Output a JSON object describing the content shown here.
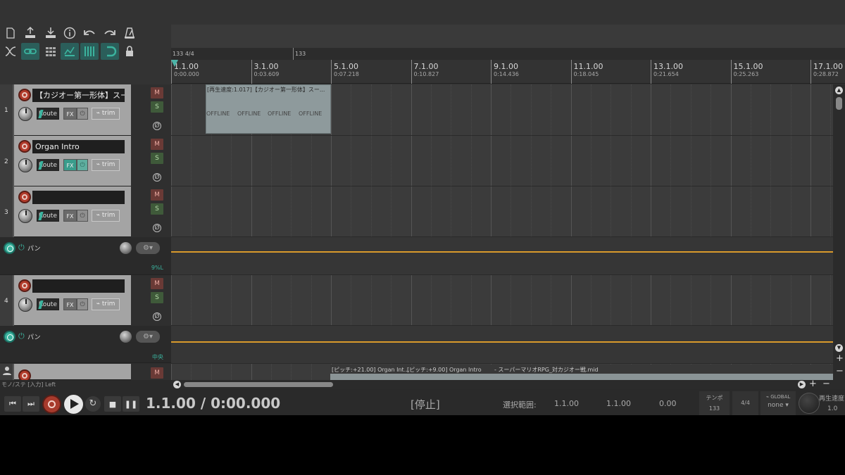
{
  "toolbar": {
    "row1": [
      "new-project-icon",
      "save-project-icon",
      "save-as-icon",
      "info-icon",
      "undo-icon",
      "redo-icon",
      "metronome-icon"
    ],
    "row2": [
      "ripple-off-icon",
      "link-icon",
      "grid-icon",
      "envelope-icon",
      "snap-grid-icon",
      "snap-magnet-icon",
      "lock-icon"
    ]
  },
  "tempo_lane": {
    "start_label": "133 4/4",
    "marker_label": "133"
  },
  "ruler": [
    {
      "bar": "1.1.00",
      "time": "0:00.000"
    },
    {
      "bar": "3.1.00",
      "time": "0:03.609"
    },
    {
      "bar": "5.1.00",
      "time": "0:07.218"
    },
    {
      "bar": "7.1.00",
      "time": "0:10.827"
    },
    {
      "bar": "9.1.00",
      "time": "0:14.436"
    },
    {
      "bar": "11.1.00",
      "time": "0:18.045"
    },
    {
      "bar": "13.1.00",
      "time": "0:21.654"
    },
    {
      "bar": "15.1.00",
      "time": "0:25.263"
    },
    {
      "bar": "17.1.00",
      "time": "0:28.872"
    }
  ],
  "tracks": [
    {
      "num": "1",
      "name": "【カジオー第一形体】スーパ",
      "route": "Route",
      "fx": "FX",
      "trim": "trim",
      "mute": "M",
      "solo": "S",
      "phase": "Ø"
    },
    {
      "num": "2",
      "name": "Organ Intro",
      "route": "Route",
      "fx": "FX",
      "trim": "trim",
      "mute": "M",
      "solo": "S",
      "phase": "Ø"
    },
    {
      "num": "3",
      "name": "",
      "route": "Route",
      "fx": "FX",
      "trim": "trim",
      "mute": "M",
      "solo": "S",
      "phase": "Ø"
    },
    {
      "num": "4",
      "name": "",
      "route": "Route",
      "fx": "FX",
      "trim": "trim",
      "mute": "M",
      "solo": "S",
      "phase": "Ø"
    },
    {
      "num": "",
      "name": "",
      "route": "",
      "fx": "",
      "trim": "",
      "mute": "M",
      "solo": "",
      "phase": ""
    }
  ],
  "envelopes": [
    {
      "label": "パン",
      "value": "9%L"
    },
    {
      "label": "パン",
      "value": "中央"
    }
  ],
  "items": {
    "item1_title": "[再生速度:1.017]【カジオー第一形体】スー...",
    "offline_label": "OFFLINE",
    "bottom_a": "[ピッチ:+21.00] Organ Int...",
    "bottom_b": "[ピッチ:+9.00] Organ Intro",
    "bottom_c": "- スーパーマリオRPG_対カジオー戦.mid"
  },
  "status_text": "モノ/ステ [入力] Left",
  "transport": {
    "time": "1.1.00 / 0:00.000",
    "state": "[停止]",
    "selection_label": "選択範囲:",
    "sel_start": "1.1.00",
    "sel_end": "1.1.00",
    "sel_len": "0.00",
    "tempo_label": "テンポ",
    "tempo_value": "133",
    "timesig": "4/4",
    "global_label": "GLOBAL",
    "global_value": "none",
    "playrate_label": "再生速度",
    "playrate_value": "1.0"
  },
  "colors": {
    "accent": "#3bb39e",
    "envelope_line": "#d99a2b",
    "record": "#b13a2a"
  }
}
